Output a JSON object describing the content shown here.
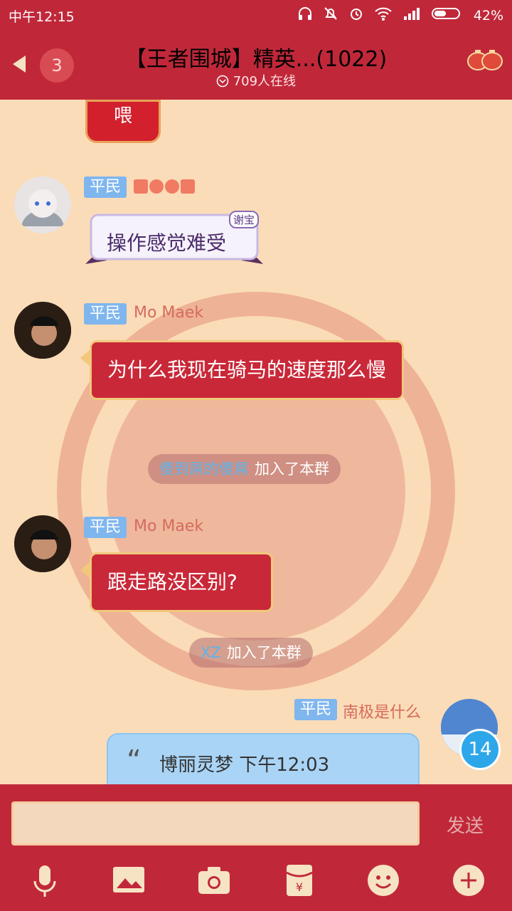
{
  "status_bar": {
    "time": "中午12:15",
    "battery": "42%"
  },
  "header": {
    "back_count": "3",
    "title": "【王者围城】精英...(1022)",
    "online": "709人在线"
  },
  "messages": [
    {
      "rank": "平民",
      "sticker_text": "操作感觉难受",
      "sticker_tag": "谢宝"
    },
    {
      "rank": "平民",
      "nick": "Mo Maek",
      "text": "为什么我现在骑马的速度那么慢"
    },
    {
      "system_who": "傻到屌的傻屌",
      "system_text": "加入了本群"
    },
    {
      "rank": "平民",
      "nick": "Mo Maek",
      "text": "跟走路没区别?"
    },
    {
      "system_who": "XZ",
      "system_text": "加入了本群"
    },
    {
      "rank": "平民",
      "nick": "南极是什么"
    }
  ],
  "quote": {
    "mark": "“",
    "text": "博丽灵梦 下午12:03"
  },
  "unread_count": "14",
  "input": {
    "send_label": "发送"
  },
  "top_sticker_text": "喂",
  "icons": [
    "back-icon",
    "lantern-icon",
    "mic-icon",
    "image-icon",
    "camera-icon",
    "red-packet-icon",
    "emoji-icon",
    "plus-icon"
  ]
}
